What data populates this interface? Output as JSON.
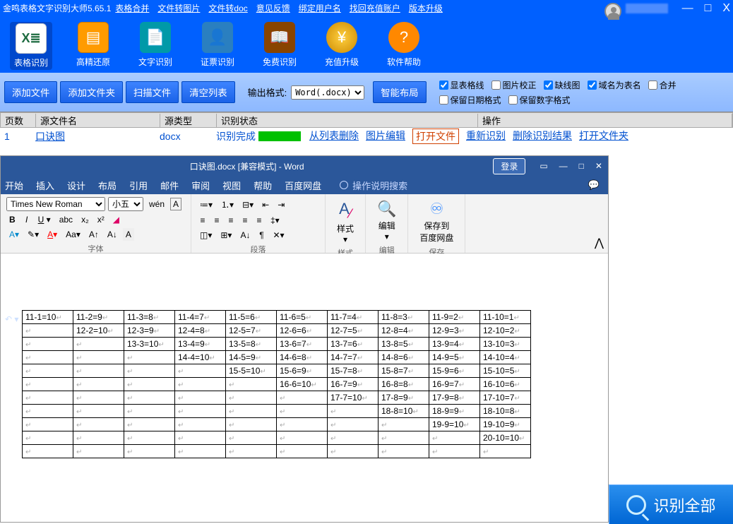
{
  "title": "金鸣表格文字识别大师5.65.1",
  "top_links": [
    "表格合并",
    "文件转图片",
    "文件转doc",
    "意见反馈",
    "绑定用户名",
    "找回充值账户",
    "版本升级"
  ],
  "win_buttons": {
    "min": "—",
    "max": "□",
    "close": "X"
  },
  "toolbar_icons": [
    {
      "name": "table-recognize",
      "glyph": "X≣",
      "label": "表格识别",
      "cls": "excel",
      "active": true
    },
    {
      "name": "high-fidelity",
      "glyph": "▤",
      "label": "高精还原",
      "cls": "orange"
    },
    {
      "name": "text-recognize",
      "glyph": "📄",
      "label": "文字识别",
      "cls": "teal"
    },
    {
      "name": "id-recognize",
      "glyph": "👤",
      "label": "证票识别",
      "cls": "blue"
    },
    {
      "name": "free-recognize",
      "glyph": "📖",
      "label": "免费识别",
      "cls": "book"
    },
    {
      "name": "recharge",
      "glyph": "¥",
      "label": "充值升级",
      "cls": "coin"
    },
    {
      "name": "help",
      "glyph": "?",
      "label": "软件帮助",
      "cls": "help"
    }
  ],
  "sec_buttons": [
    "添加文件",
    "添加文件夹",
    "扫描文件",
    "清空列表"
  ],
  "output_format_label": "输出格式:",
  "output_format": "Word(.docx)",
  "smart_layout": "智能布局",
  "checks": [
    {
      "label": "显表格线",
      "checked": true
    },
    {
      "label": "图片校正",
      "checked": false
    },
    {
      "label": "缺线图",
      "checked": true
    },
    {
      "label": "域名为表名",
      "checked": true
    },
    {
      "label": "合并",
      "checked": false
    },
    {
      "label": "保留日期格式",
      "checked": false
    },
    {
      "label": "保留数字格式",
      "checked": false
    }
  ],
  "file_headers": {
    "page": "页数",
    "name": "源文件名",
    "type": "源类型",
    "stat": "识别状态",
    "op": "操作"
  },
  "file_row": {
    "page": "1",
    "name": "口诀图",
    "type": "docx",
    "stat": "识别完成",
    "ops": [
      "从列表删除",
      "图片编辑",
      "打开文件",
      "重新识别",
      "删除识别结果",
      "打开文件夹"
    ],
    "boxed_index": 2
  },
  "word": {
    "title": "口诀图.docx [兼容模式] - Word",
    "login": "登录",
    "tabs": [
      "开始",
      "插入",
      "设计",
      "布局",
      "引用",
      "邮件",
      "审阅",
      "视图",
      "帮助",
      "百度网盘"
    ],
    "tell_me": "操作说明搜索",
    "font_name": "Times New Roman",
    "font_size": "小五",
    "groups": {
      "font": "字体",
      "para": "段落",
      "style": "样式",
      "edit": "编辑",
      "save": "保存"
    },
    "style_btn": "样式",
    "edit_btn": "编辑",
    "save_btn": "保存到\n百度网盘"
  },
  "recognize_all": "识别全部",
  "chart_data": {
    "type": "table",
    "title": "口诀图",
    "rows": [
      [
        "11-1=10",
        "11-2=9",
        "11-3=8",
        "11-4=7",
        "11-5=6",
        "11-6=5",
        "11-7=4",
        "11-8=3",
        "11-9=2",
        "11-10=1"
      ],
      [
        "",
        "12-2=10",
        "12-3=9",
        "12-4=8",
        "12-5=7",
        "12-6=6",
        "12-7=5",
        "12-8=4",
        "12-9=3",
        "12-10=2"
      ],
      [
        "",
        "",
        "13-3=10",
        "13-4=9",
        "13-5=8",
        "13-6=7",
        "13-7=6",
        "13-8=5",
        "13-9=4",
        "13-10=3"
      ],
      [
        "",
        "",
        "",
        "14-4=10",
        "14-5=9",
        "14-6=8",
        "14-7=7",
        "14-8=6",
        "14-9=5",
        "14-10=4"
      ],
      [
        "",
        "",
        "",
        "",
        "15-5=10",
        "15-6=9",
        "15-7=8",
        "15-8=7",
        "15-9=6",
        "15-10=5"
      ],
      [
        "",
        "",
        "",
        "",
        "",
        "16-6=10",
        "16-7=9",
        "16-8=8",
        "16-9=7",
        "16-10=6"
      ],
      [
        "",
        "",
        "",
        "",
        "",
        "",
        "17-7=10",
        "17-8=9",
        "17-9=8",
        "17-10=7"
      ],
      [
        "",
        "",
        "",
        "",
        "",
        "",
        "",
        "18-8=10",
        "18-9=9",
        "18-10=8"
      ],
      [
        "",
        "",
        "",
        "",
        "",
        "",
        "",
        "",
        "19-9=10",
        "19-10=9"
      ],
      [
        "",
        "",
        "",
        "",
        "",
        "",
        "",
        "",
        "",
        "20-10=10"
      ],
      [
        "",
        "",
        "",
        "",
        "",
        "",
        "",
        "",
        "",
        ""
      ]
    ]
  }
}
